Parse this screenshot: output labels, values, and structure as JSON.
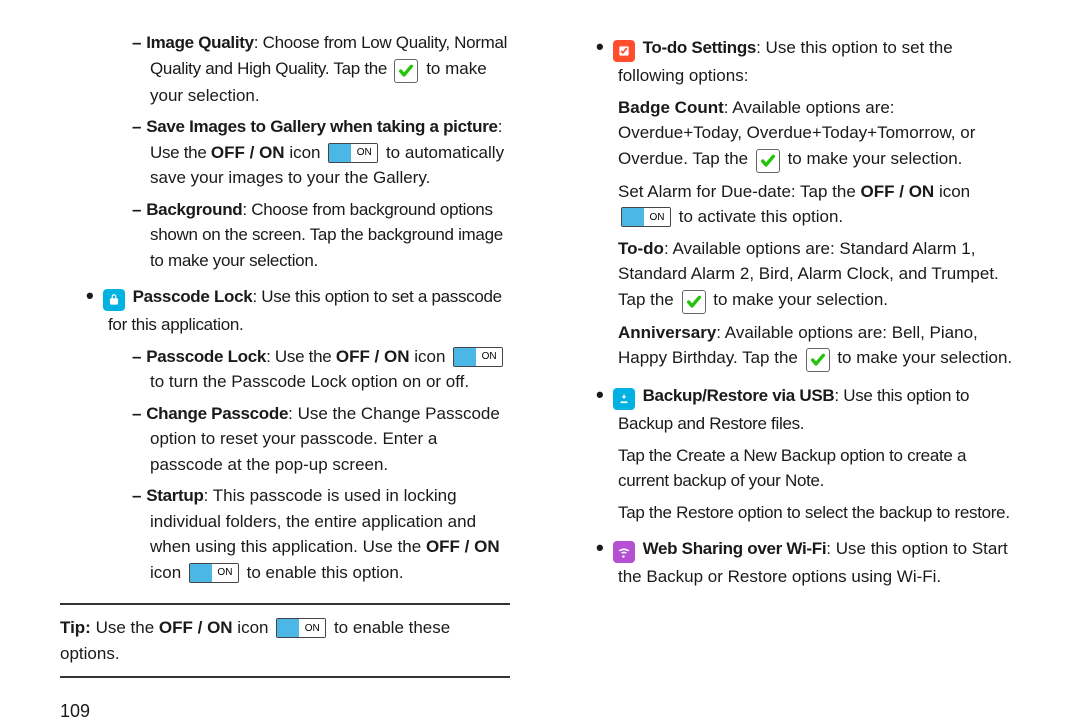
{
  "left": {
    "imgq": {
      "label": "Image Quality",
      "desc": ":  Choose from Low Quality, Normal Quality and High Quality. Tap the ",
      "desc2": " to make your selection."
    },
    "save": {
      "label": "Save Images to Gallery when taking a picture",
      "desc1": ": Use the ",
      "offon": "OFF / ON",
      "desc2": " icon ",
      "desc3": " to automatically save your images to your the Gallery."
    },
    "bg": {
      "label": "Background",
      "desc": ": Choose from background options shown on the screen. Tap the background image to make your selection."
    },
    "passcode": {
      "title": "Passcode Lock",
      "title_desc": ": Use this option to set a passcode for this application.",
      "lock_label": "Passcode Lock",
      "lock_desc1": ": Use the ",
      "offon": "OFF / ON",
      "lock_desc2": " icon ",
      "lock_desc3": " to turn the Passcode Lock option on or off.",
      "change_label": "Change Passcode",
      "change_desc": ": Use the Change Passcode option to reset your passcode. Enter a passcode at the pop-up screen.",
      "startup_label": "Startup",
      "startup_desc1": ": This passcode is used in locking individual folders, the entire application and when using this application. Use the ",
      "startup_desc2": " icon ",
      "startup_desc3": " to enable this option."
    },
    "tip": {
      "label": "Tip:",
      "desc1": " Use the ",
      "offon": "OFF / ON",
      "desc2": " icon ",
      "desc3": " to enable these options."
    },
    "page": "109"
  },
  "right": {
    "todo": {
      "title": "To-do Settings",
      "title_desc": ": Use this option to set the following options:",
      "badge_label": "Badge Count",
      "badge_desc1": ": Available options are: Overdue+Today, Overdue+Today+Tomorrow, or Overdue. Tap the ",
      "badge_desc2": " to make your selection.",
      "alarm_desc1": "Set Alarm for Due-date: Tap the ",
      "offon": "OFF / ON",
      "alarm_desc2": " icon ",
      "alarm_desc3": " to activate this option.",
      "todo_label": "To-do",
      "todo_desc1": ": Available options are: Standard Alarm 1, Standard Alarm 2, Bird, Alarm Clock, and Trumpet. Tap the ",
      "todo_desc2": " to make your selection.",
      "anniv_label": "Anniversary",
      "anniv_desc1": ": Available options are: Bell, Piano, Happy Birthday. Tap the ",
      "anniv_desc2": " to make your selection."
    },
    "backup": {
      "title": "Backup/Restore via USB",
      "title_desc": ": Use this option to Backup and Restore files.",
      "l1": "Tap the Create a New Backup option to create a current backup of your Note.",
      "l2": "Tap the Restore option to select the backup to restore."
    },
    "wifi": {
      "title": "Web Sharing over Wi-Fi",
      "desc": ": Use this option to Start the Backup or Restore options using Wi-Fi."
    }
  },
  "toggle_on": "ON"
}
